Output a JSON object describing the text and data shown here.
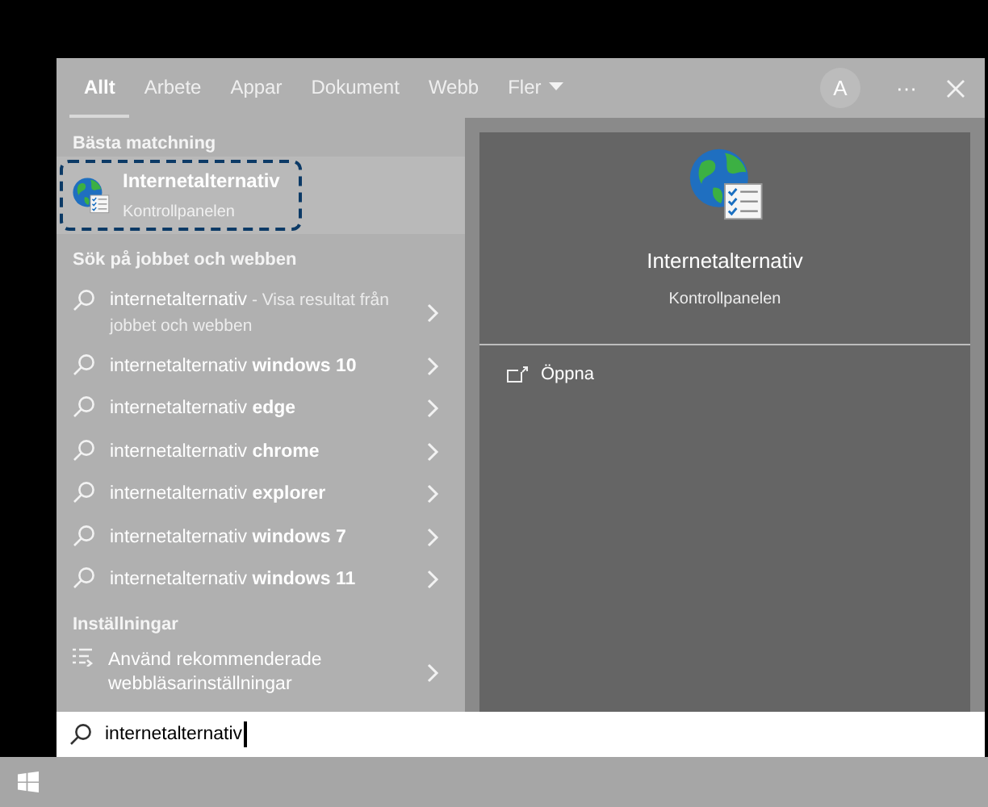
{
  "tabs": [
    {
      "label": "Allt",
      "selected": true
    },
    {
      "label": "Arbete",
      "selected": false
    },
    {
      "label": "Appar",
      "selected": false
    },
    {
      "label": "Dokument",
      "selected": false
    },
    {
      "label": "Webb",
      "selected": false
    },
    {
      "label": "Fler",
      "selected": false,
      "dropdown": true
    }
  ],
  "account": {
    "initial": "A"
  },
  "more": "···",
  "best_match": {
    "heading": "Bästa matchning",
    "title": "Internetalternativ",
    "subtitle": "Kontrollpanelen",
    "selected": true
  },
  "web_section": {
    "heading": "Sök på jobbet och webben",
    "suggestions": [
      {
        "text": "internetalternativ",
        "hint": "- Visa resultat från jobbet och webben"
      },
      {
        "text": "internetalternativ **windows 10**"
      },
      {
        "text": "internetalternativ **edge**"
      },
      {
        "text": "internetalternativ **chrome**"
      },
      {
        "text": "internetalternativ **explorer**"
      },
      {
        "text": "internetalternativ **windows 7**"
      },
      {
        "text": "internetalternativ **windows 11**"
      }
    ]
  },
  "settings_section": {
    "heading": "Inställningar",
    "items": [
      {
        "text": "Använd rekommenderade webbläsarinställningar"
      }
    ]
  },
  "preview": {
    "title": "Internetalternativ",
    "subtitle": "Kontrollpanelen",
    "actions": [
      {
        "label": "Öppna"
      }
    ]
  },
  "search": {
    "value": "internetalternativ"
  }
}
